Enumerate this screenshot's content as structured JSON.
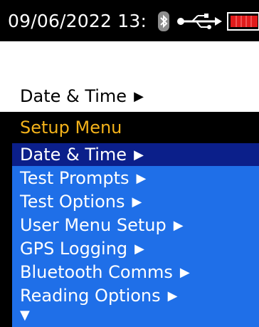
{
  "status_bar": {
    "datetime": "09/06/2022 13:",
    "bluetooth_icon": "bluetooth-icon",
    "usb_icon": "usb-icon",
    "battery_icon": "battery-icon",
    "battery_color": "#e01b1b"
  },
  "breadcrumb": {
    "label": "Date & Time",
    "arrow": "▶"
  },
  "menu": {
    "title": "Setup Menu",
    "items": [
      {
        "label": "Date & Time",
        "arrow": "▶",
        "selected": true
      },
      {
        "label": "Test Prompts",
        "arrow": "▶",
        "selected": false
      },
      {
        "label": "Test Options",
        "arrow": "▶",
        "selected": false
      },
      {
        "label": "User Menu Setup",
        "arrow": "▶",
        "selected": false
      },
      {
        "label": "GPS Logging",
        "arrow": "▶",
        "selected": false
      },
      {
        "label": "Bluetooth Comms",
        "arrow": "▶",
        "selected": false
      },
      {
        "label": "Reading Options",
        "arrow": "▶",
        "selected": false
      }
    ],
    "more_indicator": "▼"
  },
  "colors": {
    "accent_blue": "#1f6fe8",
    "selected_blue": "#0b1f8a",
    "title_orange": "#f3b21a"
  }
}
